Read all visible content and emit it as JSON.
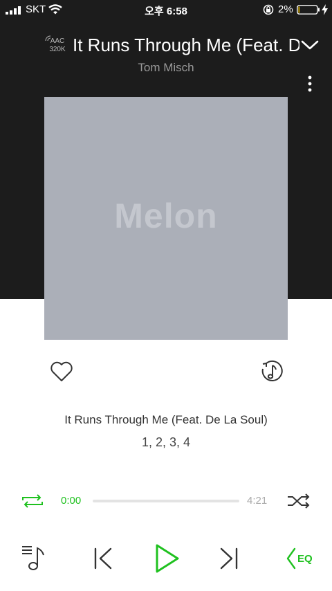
{
  "status_bar": {
    "carrier": "SKT",
    "time": "오후 6:58",
    "battery_percent": "2%",
    "battery_level": 0.02
  },
  "header": {
    "codec_line1": "AAC",
    "codec_line2": "320K",
    "song_title": "It Runs Through Me (Feat. De La Soul)",
    "artist": "Tom Misch"
  },
  "album_art": {
    "placeholder_logo": "Melon"
  },
  "song_info": {
    "title": "It Runs Through Me (Feat. De La Soul)",
    "album": "1, 2, 3, 4"
  },
  "progress": {
    "current_time": "0:00",
    "total_time": "4:21",
    "fraction": 0.0
  },
  "colors": {
    "accent": "#1fc11f",
    "header_background": "#1c1c1c",
    "album_placeholder": "#abafb8"
  },
  "icons": {
    "heart": "heart-icon",
    "music_history": "music-history-icon",
    "repeat": "repeat-icon",
    "shuffle": "shuffle-icon",
    "playlist": "playlist-icon",
    "previous": "previous-icon",
    "play": "play-icon",
    "next": "next-icon",
    "eq": "eq-icon"
  },
  "controls": {
    "eq_label": "EQ"
  }
}
